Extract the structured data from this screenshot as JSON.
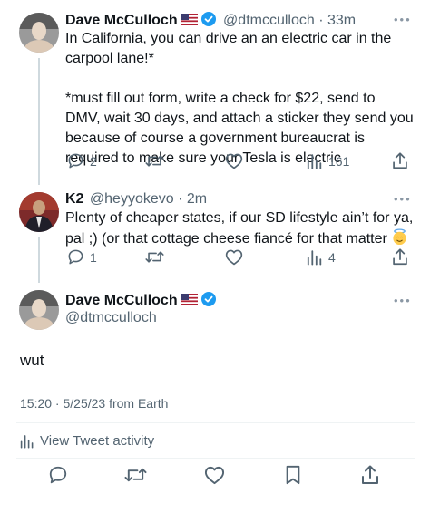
{
  "tweet1": {
    "name": "Dave McCulloch",
    "handle": "@dtmcculloch",
    "time": "· 33m",
    "text": "In California, you can drive an an electric car in the carpool lane!*\n\n*must fill out form, write a check for $22, send to DMV, wait 30 days, and attach a sticker they send you because of course a government bureaucrat is required to make sure your Tesla is electric",
    "replies": "2",
    "retweets": "",
    "likes": "",
    "views": "161"
  },
  "tweet2": {
    "name": "K2",
    "handle": "@heyyokevo",
    "time": "· 2m",
    "text": "Plenty of cheaper states, if our SD lifestyle ain’t for ya, pal ;) (or that cottage cheese fiancé for that matter ",
    "emoji": "smiling-face-with-halo",
    "replies": "1",
    "views": "4"
  },
  "main_tweet": {
    "name": "Dave McCulloch",
    "handle": "@dtmcculloch",
    "text": "wut",
    "timestamp": "15:20 · 5/25/23 from Earth",
    "activity_label": "View Tweet activity"
  },
  "colors": {
    "text": "#0f1419",
    "secondary": "#536471",
    "verified": "#1d9bf0",
    "thread_line": "#cfd9de"
  },
  "icons": [
    "reply-icon",
    "retweet-icon",
    "like-icon",
    "views-icon",
    "share-icon",
    "bookmark-icon",
    "verified-icon",
    "more-icon"
  ]
}
